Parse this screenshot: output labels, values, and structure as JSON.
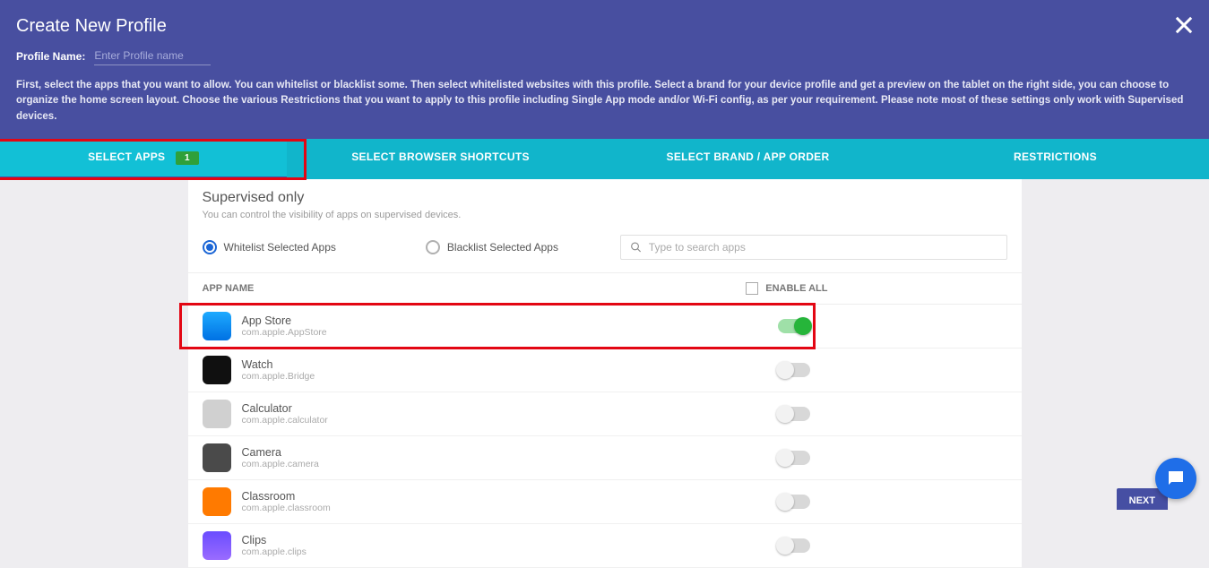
{
  "header": {
    "title": "Create New Profile",
    "profile_name_label": "Profile Name:",
    "profile_name_placeholder": "Enter Profile name",
    "description": "First, select the apps that you want to allow. You can whitelist or blacklist some. Then select whitelisted websites with this profile. Select a brand for your device profile and get a preview on the tablet on the right side, you can choose to organize the home screen layout. Choose the various Restrictions that you want to apply to this profile including Single App mode and/or Wi-Fi config, as per your requirement. Please note most of these settings only work with Supervised devices."
  },
  "tabs": {
    "select_apps": "SELECT APPS",
    "select_apps_badge": "1",
    "browser_shortcuts": "SELECT BROWSER SHORTCUTS",
    "brand_order": "SELECT BRAND / APP ORDER",
    "restrictions": "RESTRICTIONS"
  },
  "card": {
    "title": "Supervised only",
    "subtitle": "You can control the visibility of apps on supervised devices.",
    "whitelist_label": "Whitelist Selected Apps",
    "blacklist_label": "Blacklist Selected Apps",
    "search_placeholder": "Type to search apps",
    "col_app": "APP NAME",
    "col_enable": "ENABLE ALL"
  },
  "apps": [
    {
      "name": "App Store",
      "id": "com.apple.AppStore",
      "enabled": true,
      "icon": "ic-appstore"
    },
    {
      "name": "Watch",
      "id": "com.apple.Bridge",
      "enabled": false,
      "icon": "ic-watch"
    },
    {
      "name": "Calculator",
      "id": "com.apple.calculator",
      "enabled": false,
      "icon": "ic-calc"
    },
    {
      "name": "Camera",
      "id": "com.apple.camera",
      "enabled": false,
      "icon": "ic-camera"
    },
    {
      "name": "Classroom",
      "id": "com.apple.classroom",
      "enabled": false,
      "icon": "ic-classroom"
    },
    {
      "name": "Clips",
      "id": "com.apple.clips",
      "enabled": false,
      "icon": "ic-clips"
    }
  ],
  "footer": {
    "next": "NEXT"
  }
}
